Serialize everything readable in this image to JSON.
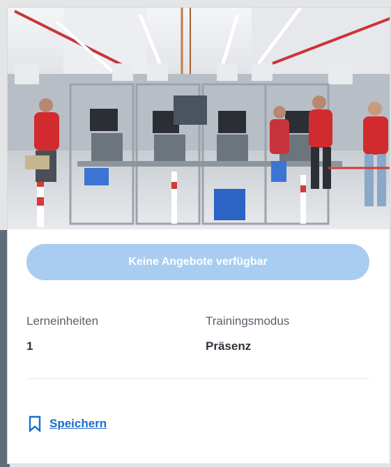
{
  "card": {
    "image": {
      "description": "factory-assembly-line-photo"
    },
    "offer_button_label": "Keine Angebote verfügbar",
    "details": [
      {
        "label": "Lerneinheiten",
        "value": "1"
      },
      {
        "label": "Trainingsmodus",
        "value": "Präsenz"
      }
    ],
    "save_label": "Speichern"
  },
  "colors": {
    "accent": "#1a6ccf",
    "button_disabled": "#a9cdf0"
  },
  "icons": {
    "save": "bookmark-icon"
  }
}
